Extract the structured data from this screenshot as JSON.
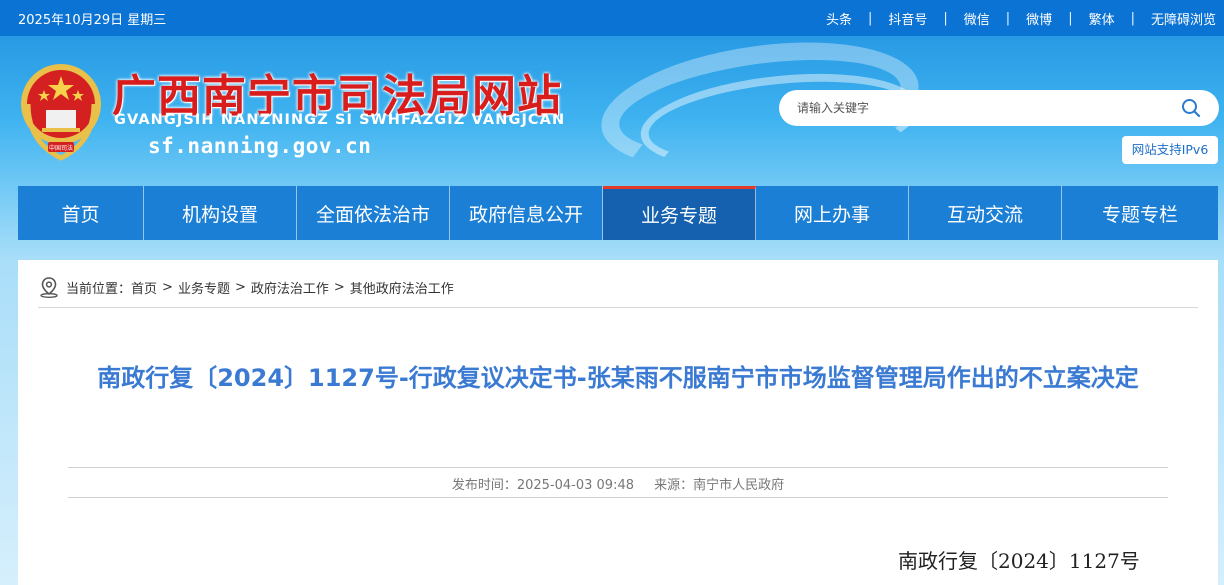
{
  "topbar": {
    "date": "2025年10月29日 星期三",
    "links": [
      "头条",
      "抖音号",
      "微信",
      "微博",
      "繁体",
      "无障碍浏览"
    ],
    "separator": "|"
  },
  "header": {
    "title": "广西南宁市司法局网站",
    "subtitle": "GVANGJSIH NANZNINGZ SI SWHFAZGIZ VANGJCAN",
    "domain": "sf.nanning.gov.cn",
    "emblem_text": "中国司法",
    "search_placeholder": "请输入关键字",
    "ipv6_badge": "网站支持IPv6"
  },
  "nav": {
    "items": [
      "首页",
      "机构设置",
      "全面依法治市",
      "政府信息公开",
      "业务专题",
      "网上办事",
      "互动交流",
      "专题专栏"
    ],
    "active_index": 4
  },
  "breadcrumb": {
    "label": "当前位置：",
    "items": [
      "首页",
      "业务专题",
      "政府法治工作",
      "其他政府法治工作"
    ],
    "arrow": ">"
  },
  "article": {
    "title": "南政行复〔2024〕1127号-行政复议决定书-张某雨不服南宁市市场监督管理局作出的不立案决定",
    "publish_time": "发布时间：2025-04-03 09:48",
    "source": "来源：南宁市人民政府",
    "doc_number": "南政行复〔2024〕1127号"
  },
  "colors": {
    "topbar": "#0b73d4",
    "nav": "#1c7fd6",
    "nav_active": "#1561b0",
    "title_red": "#d91c1c",
    "article_title": "#3a7ad3"
  }
}
